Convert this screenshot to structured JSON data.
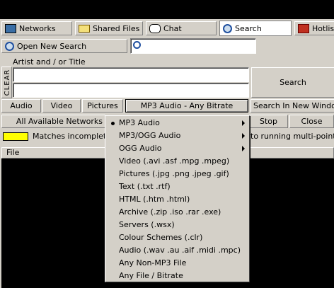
{
  "toolbar": {
    "tabs": [
      {
        "label": "Networks",
        "icon": "network-icon"
      },
      {
        "label": "Shared Files",
        "icon": "folder-icon"
      },
      {
        "label": "Chat",
        "icon": "chat-icon"
      },
      {
        "label": "Search",
        "icon": "search-icon"
      },
      {
        "label": "Hotlist",
        "icon": "hotlist-icon"
      }
    ]
  },
  "search": {
    "open_new_label": "Open New Search",
    "artist_title_label": "Artist and / or Title",
    "clear_label": "CLEAR",
    "search_button": "Search",
    "categories": [
      "Audio",
      "Video",
      "Pictures"
    ],
    "format_selected": "MP3 Audio - Any Bitrate",
    "search_new_window": "Search In New Window",
    "networks_label": "All Available Networks",
    "stop_button": "Stop",
    "close_button": "Close",
    "matches_incomplete": "Matches incomplete",
    "status_text": "to running multi-point do",
    "file_column": "File"
  },
  "menu": {
    "items": [
      {
        "label": "MP3 Audio",
        "selected": true,
        "submenu": true
      },
      {
        "label": "MP3/OGG Audio",
        "selected": false,
        "submenu": true
      },
      {
        "label": "OGG Audio",
        "selected": false,
        "submenu": true
      },
      {
        "label": "Video (.avi .asf .mpg .mpeg)",
        "selected": false,
        "submenu": false
      },
      {
        "label": "Pictures (.jpg .png .jpeg .gif)",
        "selected": false,
        "submenu": false
      },
      {
        "label": "Text (.txt .rtf)",
        "selected": false,
        "submenu": false
      },
      {
        "label": "HTML (.htm .html)",
        "selected": false,
        "submenu": false
      },
      {
        "label": "Archive (.zip .iso .rar .exe)",
        "selected": false,
        "submenu": false
      },
      {
        "label": "Servers (.wsx)",
        "selected": false,
        "submenu": false
      },
      {
        "label": "Colour Schemes (.clr)",
        "selected": false,
        "submenu": false
      },
      {
        "label": "Audio (.wav .au .aif .midi .mpc)",
        "selected": false,
        "submenu": false
      },
      {
        "label": "Any Non-MP3 File",
        "selected": false,
        "submenu": false
      },
      {
        "label": "Any File / Bitrate",
        "selected": false,
        "submenu": false
      }
    ]
  },
  "colors": {
    "title_bar": "#000000",
    "face": "#d4d0c8",
    "matches_swatch": "#ffff00",
    "results_bg": "#000000"
  }
}
